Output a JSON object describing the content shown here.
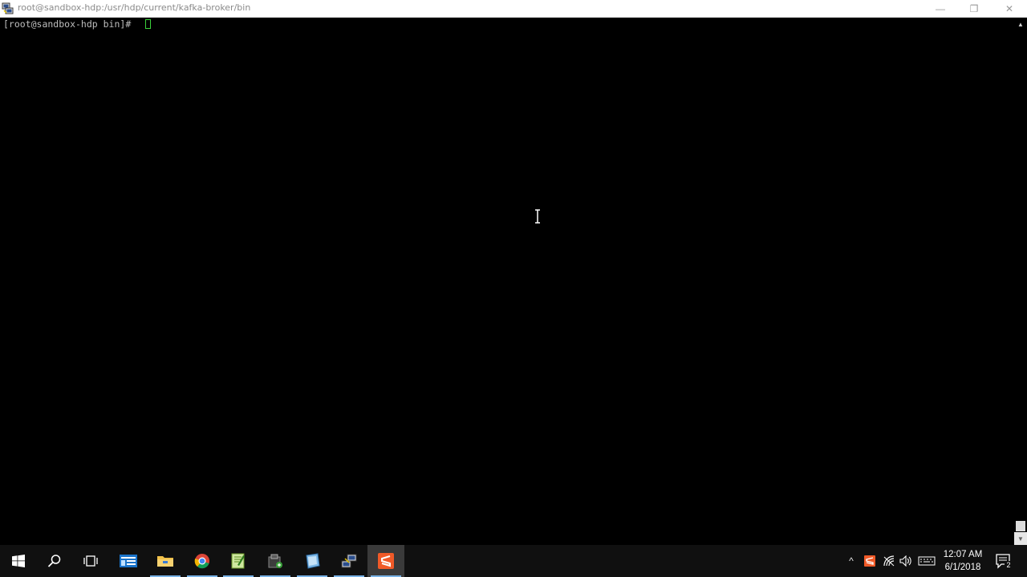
{
  "window": {
    "title": "root@sandbox-hdp:/usr/hdp/current/kafka-broker/bin",
    "minimize_symbol": "—",
    "maximize_symbol": "❐",
    "close_symbol": "✕"
  },
  "terminal": {
    "prompt": "[root@sandbox-hdp bin]# ",
    "cursor_color": "#3bd23b"
  },
  "scrollbar": {
    "up_symbol": "▲",
    "down_symbol": "▼"
  },
  "taskbar": {
    "items": [
      {
        "name": "start-icon"
      },
      {
        "name": "search-icon"
      },
      {
        "name": "task-view-icon"
      },
      {
        "name": "server-manager-icon"
      },
      {
        "name": "file-explorer-icon"
      },
      {
        "name": "chrome-icon"
      },
      {
        "name": "notepad-plus-plus-icon"
      },
      {
        "name": "package-icon"
      },
      {
        "name": "virtualbox-icon"
      },
      {
        "name": "remote-desktop-icon"
      },
      {
        "name": "sublime-text-icon"
      }
    ],
    "tray": {
      "chevron": "^",
      "time": "12:07 AM",
      "date": "6/1/2018",
      "notification_count": "2"
    }
  }
}
